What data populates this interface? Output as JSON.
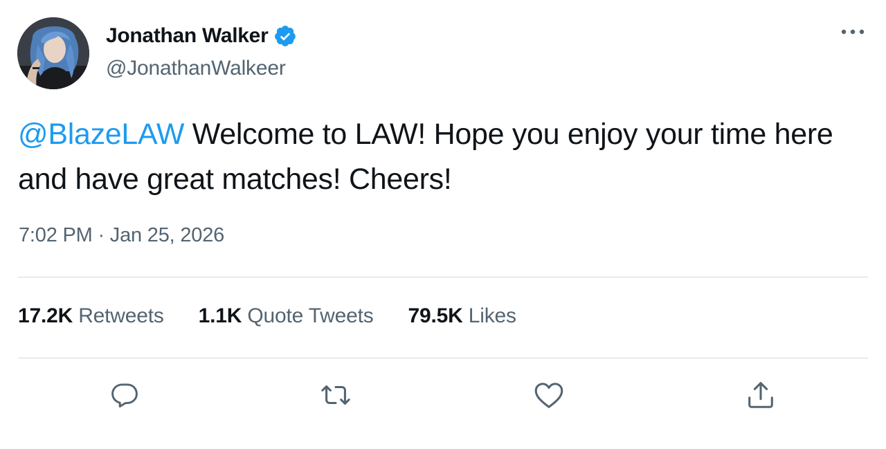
{
  "author": {
    "display_name": "Jonathan Walker",
    "handle": "@JonathanWalkeer",
    "verified": true,
    "avatar_icon": "anime-avatar-blue-hair"
  },
  "tweet": {
    "mention": "@BlazeLAW",
    "text": " Welcome to LAW! Hope you enjoy your time here and have great matches! Cheers!",
    "timestamp": "7:02 PM · Jan 25, 2026"
  },
  "stats": {
    "retweets_count": "17.2K",
    "retweets_label": "Retweets",
    "quotes_count": "1.1K",
    "quotes_label": "Quote Tweets",
    "likes_count": "79.5K",
    "likes_label": "Likes"
  },
  "actions": [
    {
      "name": "reply",
      "icon": "reply-icon"
    },
    {
      "name": "retweet",
      "icon": "retweet-icon"
    },
    {
      "name": "like",
      "icon": "heart-icon"
    },
    {
      "name": "share",
      "icon": "share-icon"
    }
  ],
  "colors": {
    "accent": "#1d9bf0",
    "primary_text": "#0f1419",
    "secondary_text": "#536471",
    "icon": "#536471",
    "divider": "#cfd9de"
  }
}
